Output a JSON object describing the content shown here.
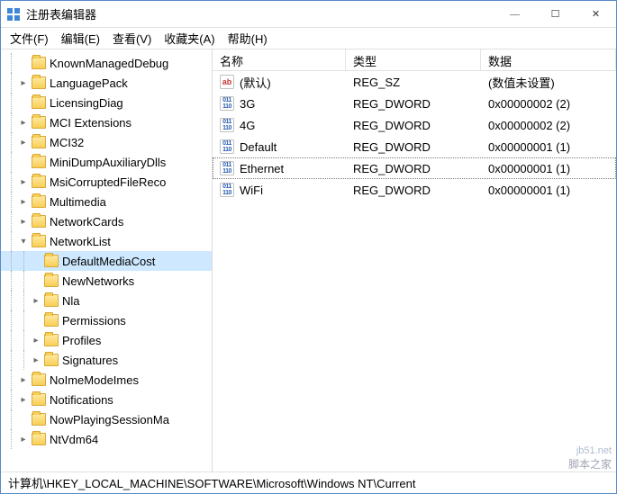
{
  "window": {
    "title": "注册表编辑器"
  },
  "menu": {
    "file": "文件(F)",
    "edit": "编辑(E)",
    "view": "查看(V)",
    "favorites": "收藏夹(A)",
    "help": "帮助(H)"
  },
  "tree": {
    "items": [
      {
        "label": "KnownManagedDebug",
        "indent": 1,
        "twisty": ""
      },
      {
        "label": "LanguagePack",
        "indent": 1,
        "twisty": "closed"
      },
      {
        "label": "LicensingDiag",
        "indent": 1,
        "twisty": ""
      },
      {
        "label": "MCI Extensions",
        "indent": 1,
        "twisty": "closed"
      },
      {
        "label": "MCI32",
        "indent": 1,
        "twisty": "closed"
      },
      {
        "label": "MiniDumpAuxiliaryDlls",
        "indent": 1,
        "twisty": ""
      },
      {
        "label": "MsiCorruptedFileReco",
        "indent": 1,
        "twisty": "closed"
      },
      {
        "label": "Multimedia",
        "indent": 1,
        "twisty": "closed"
      },
      {
        "label": "NetworkCards",
        "indent": 1,
        "twisty": "closed"
      },
      {
        "label": "NetworkList",
        "indent": 1,
        "twisty": "open"
      },
      {
        "label": "DefaultMediaCost",
        "indent": 2,
        "twisty": "",
        "selected": true
      },
      {
        "label": "NewNetworks",
        "indent": 2,
        "twisty": ""
      },
      {
        "label": "Nla",
        "indent": 2,
        "twisty": "closed"
      },
      {
        "label": "Permissions",
        "indent": 2,
        "twisty": ""
      },
      {
        "label": "Profiles",
        "indent": 2,
        "twisty": "closed"
      },
      {
        "label": "Signatures",
        "indent": 2,
        "twisty": "closed"
      },
      {
        "label": "NoImeModeImes",
        "indent": 1,
        "twisty": "closed"
      },
      {
        "label": "Notifications",
        "indent": 1,
        "twisty": "closed"
      },
      {
        "label": "NowPlayingSessionMa",
        "indent": 1,
        "twisty": ""
      },
      {
        "label": "NtVdm64",
        "indent": 1,
        "twisty": "closed"
      }
    ]
  },
  "listHeaders": {
    "name": "名称",
    "type": "类型",
    "data": "数据"
  },
  "values": [
    {
      "name": "(默认)",
      "type": "REG_SZ",
      "data": "(数值未设置)",
      "icon": "sz"
    },
    {
      "name": "3G",
      "type": "REG_DWORD",
      "data": "0x00000002 (2)",
      "icon": "dw"
    },
    {
      "name": "4G",
      "type": "REG_DWORD",
      "data": "0x00000002 (2)",
      "icon": "dw"
    },
    {
      "name": "Default",
      "type": "REG_DWORD",
      "data": "0x00000001 (1)",
      "icon": "dw"
    },
    {
      "name": "Ethernet",
      "type": "REG_DWORD",
      "data": "0x00000001 (1)",
      "icon": "dw",
      "selected": true
    },
    {
      "name": "WiFi",
      "type": "REG_DWORD",
      "data": "0x00000001 (1)",
      "icon": "dw"
    }
  ],
  "statusbar": "计算机\\HKEY_LOCAL_MACHINE\\SOFTWARE\\Microsoft\\Windows NT\\Current",
  "watermark": {
    "line1": "jb51.net",
    "line2": "脚本之家"
  }
}
